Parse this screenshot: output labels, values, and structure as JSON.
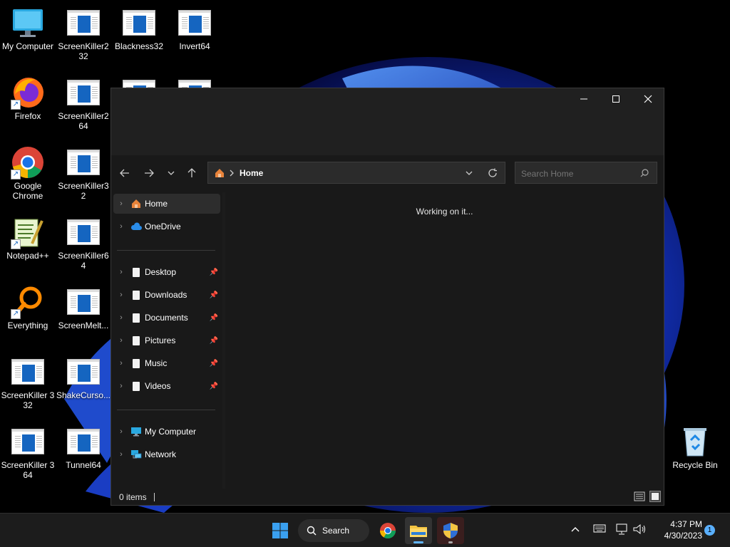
{
  "desktop": {
    "icons": [
      {
        "label": "My Computer"
      },
      {
        "label": "ScreenKiller2 32"
      },
      {
        "label": "Blackness32"
      },
      {
        "label": "Invert64"
      },
      {
        "label": "Firefox"
      },
      {
        "label": "ScreenKiller2 64"
      },
      {
        "label": "Google Chrome"
      },
      {
        "label": "ScreenKiller32"
      },
      {
        "label": "Notepad++"
      },
      {
        "label": "ScreenKiller64"
      },
      {
        "label": "Everything"
      },
      {
        "label": "ScreenMelt..."
      },
      {
        "label": "ScreenKiller 3 32"
      },
      {
        "label": "ShakeCurso..."
      },
      {
        "label": "ScreenKiller 3 64"
      },
      {
        "label": "Tunnel64"
      },
      {
        "label": "Recycle Bin"
      }
    ]
  },
  "explorer": {
    "address": {
      "location": "Home"
    },
    "search": {
      "placeholder": "Search Home"
    },
    "sidebar": {
      "items": [
        {
          "label": "Home"
        },
        {
          "label": "OneDrive"
        },
        {
          "label": "Desktop"
        },
        {
          "label": "Downloads"
        },
        {
          "label": "Documents"
        },
        {
          "label": "Pictures"
        },
        {
          "label": "Music"
        },
        {
          "label": "Videos"
        },
        {
          "label": "My Computer"
        },
        {
          "label": "Network"
        }
      ]
    },
    "content": {
      "status_message": "Working on it..."
    },
    "statusbar": {
      "items_count": "0 items"
    }
  },
  "taskbar": {
    "search_label": "Search",
    "clock": {
      "time": "4:37 PM",
      "date": "4/30/2023"
    },
    "notification_count": "1"
  },
  "colors": {
    "accent": "#0078d4",
    "window_bg": "#202020",
    "pane_bg": "#191919",
    "taskbar_bg": "#1c1c1c"
  }
}
